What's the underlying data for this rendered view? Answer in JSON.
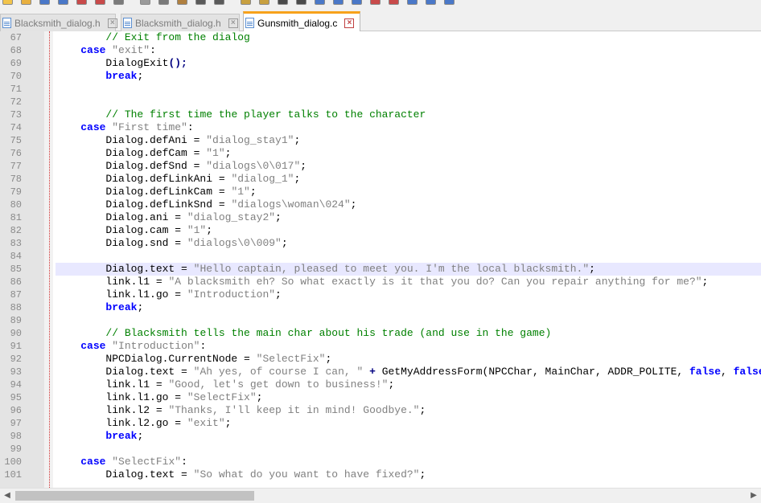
{
  "toolbar": {
    "icons": [
      "new-icon",
      "open-icon",
      "save-icon",
      "save-all-icon",
      "close-icon",
      "close-all-icon",
      "print-icon",
      "cut-icon",
      "copy-icon",
      "paste-icon",
      "undo-icon",
      "redo-icon",
      "find-icon",
      "replace-icon",
      "zoom-in-icon",
      "zoom-out-icon",
      "sync-icon",
      "wrap-icon",
      "indent-icon",
      "bookmark-icon",
      "macro-record-icon",
      "macro-play-icon",
      "macro-save-icon",
      "run-icon"
    ]
  },
  "tabs": [
    {
      "label": "Blacksmith_dialog.h",
      "active": false
    },
    {
      "label": "Blacksmith_dialog.h",
      "active": false
    },
    {
      "label": "Gunsmith_dialog.c",
      "active": true
    }
  ],
  "editor": {
    "current_line": 85,
    "lines": [
      {
        "n": "67",
        "t": [
          [
            "",
            "        "
          ],
          [
            "cm",
            "// Exit from the dialog"
          ]
        ]
      },
      {
        "n": "68",
        "t": [
          [
            "",
            "    "
          ],
          [
            "kw",
            "case"
          ],
          [
            "",
            " "
          ],
          [
            "st",
            "\"exit\""
          ],
          [
            "",
            ":"
          ]
        ]
      },
      {
        "n": "69",
        "t": [
          [
            "",
            "        DialogExit"
          ],
          [
            "op",
            "();"
          ]
        ]
      },
      {
        "n": "70",
        "t": [
          [
            "",
            "        "
          ],
          [
            "kw",
            "break"
          ],
          [
            "",
            ";"
          ]
        ]
      },
      {
        "n": "71",
        "t": []
      },
      {
        "n": "72",
        "t": []
      },
      {
        "n": "73",
        "t": [
          [
            "",
            "        "
          ],
          [
            "cm",
            "// The first time the player talks to the character"
          ]
        ]
      },
      {
        "n": "74",
        "t": [
          [
            "",
            "    "
          ],
          [
            "kw",
            "case"
          ],
          [
            "",
            " "
          ],
          [
            "st",
            "\"First time\""
          ],
          [
            "",
            ":"
          ]
        ]
      },
      {
        "n": "75",
        "t": [
          [
            "",
            "        Dialog.defAni = "
          ],
          [
            "st",
            "\"dialog_stay1\""
          ],
          [
            "",
            ";"
          ]
        ]
      },
      {
        "n": "76",
        "t": [
          [
            "",
            "        Dialog.defCam = "
          ],
          [
            "st",
            "\"1\""
          ],
          [
            "",
            ";"
          ]
        ]
      },
      {
        "n": "77",
        "t": [
          [
            "",
            "        Dialog.defSnd = "
          ],
          [
            "st",
            "\"dialogs\\0\\017\""
          ],
          [
            "",
            ";"
          ]
        ]
      },
      {
        "n": "78",
        "t": [
          [
            "",
            "        Dialog.defLinkAni = "
          ],
          [
            "st",
            "\"dialog_1\""
          ],
          [
            "",
            ";"
          ]
        ]
      },
      {
        "n": "79",
        "t": [
          [
            "",
            "        Dialog.defLinkCam = "
          ],
          [
            "st",
            "\"1\""
          ],
          [
            "",
            ";"
          ]
        ]
      },
      {
        "n": "80",
        "t": [
          [
            "",
            "        Dialog.defLinkSnd = "
          ],
          [
            "st",
            "\"dialogs\\woman\\024\""
          ],
          [
            "",
            ";"
          ]
        ]
      },
      {
        "n": "81",
        "t": [
          [
            "",
            "        Dialog.ani = "
          ],
          [
            "st",
            "\"dialog_stay2\""
          ],
          [
            "",
            ";"
          ]
        ]
      },
      {
        "n": "82",
        "t": [
          [
            "",
            "        Dialog.cam = "
          ],
          [
            "st",
            "\"1\""
          ],
          [
            "",
            ";"
          ]
        ]
      },
      {
        "n": "83",
        "t": [
          [
            "",
            "        Dialog.snd = "
          ],
          [
            "st",
            "\"dialogs\\0\\009\""
          ],
          [
            "",
            ";"
          ]
        ]
      },
      {
        "n": "84",
        "t": []
      },
      {
        "n": "85",
        "t": [
          [
            "",
            "        Dialog.text = "
          ],
          [
            "st",
            "\"Hello captain, pleased to meet you. I'm the local blacksmith.\""
          ],
          [
            "",
            ";"
          ]
        ]
      },
      {
        "n": "86",
        "t": [
          [
            "",
            "        link.l1 = "
          ],
          [
            "st",
            "\"A blacksmith eh? So what exactly is it that you do? Can you repair anything for me?\""
          ],
          [
            "",
            ";"
          ]
        ]
      },
      {
        "n": "87",
        "t": [
          [
            "",
            "        link.l1.go = "
          ],
          [
            "st",
            "\"Introduction\""
          ],
          [
            "",
            ";"
          ]
        ]
      },
      {
        "n": "88",
        "t": [
          [
            "",
            "        "
          ],
          [
            "kw",
            "break"
          ],
          [
            "",
            ";"
          ]
        ]
      },
      {
        "n": "89",
        "t": []
      },
      {
        "n": "90",
        "t": [
          [
            "",
            "        "
          ],
          [
            "cm",
            "// Blacksmith tells the main char about his trade (and use in the game)"
          ]
        ]
      },
      {
        "n": "91",
        "t": [
          [
            "",
            "    "
          ],
          [
            "kw",
            "case"
          ],
          [
            "",
            " "
          ],
          [
            "st",
            "\"Introduction\""
          ],
          [
            "",
            ":"
          ]
        ]
      },
      {
        "n": "92",
        "t": [
          [
            "",
            "        NPCDialog.CurrentNode = "
          ],
          [
            "st",
            "\"SelectFix\""
          ],
          [
            "",
            ";"
          ]
        ]
      },
      {
        "n": "93",
        "t": [
          [
            "",
            "        Dialog.text = "
          ],
          [
            "st",
            "\"Ah yes, of course I can, \""
          ],
          [
            "",
            " "
          ],
          [
            "op",
            "+"
          ],
          [
            "",
            " GetMyAddressForm(NPCChar, MainChar, ADDR_POLITE, "
          ],
          [
            "kw",
            "false"
          ],
          [
            "",
            ", "
          ],
          [
            "kw",
            "false"
          ]
        ]
      },
      {
        "n": "94",
        "t": [
          [
            "",
            "        link.l1 = "
          ],
          [
            "st",
            "\"Good, let's get down to business!\""
          ],
          [
            "",
            ";"
          ]
        ]
      },
      {
        "n": "95",
        "t": [
          [
            "",
            "        link.l1.go = "
          ],
          [
            "st",
            "\"SelectFix\""
          ],
          [
            "",
            ";"
          ]
        ]
      },
      {
        "n": "96",
        "t": [
          [
            "",
            "        link.l2 = "
          ],
          [
            "st",
            "\"Thanks, I'll keep it in mind! Goodbye.\""
          ],
          [
            "",
            ";"
          ]
        ]
      },
      {
        "n": "97",
        "t": [
          [
            "",
            "        link.l2.go = "
          ],
          [
            "st",
            "\"exit\""
          ],
          [
            "",
            ";"
          ]
        ]
      },
      {
        "n": "98",
        "t": [
          [
            "",
            "        "
          ],
          [
            "kw",
            "break"
          ],
          [
            "",
            ";"
          ]
        ]
      },
      {
        "n": "99",
        "t": []
      },
      {
        "n": "100",
        "t": [
          [
            "",
            "    "
          ],
          [
            "kw",
            "case"
          ],
          [
            "",
            " "
          ],
          [
            "st",
            "\"SelectFix\""
          ],
          [
            "",
            ":"
          ]
        ]
      },
      {
        "n": "101",
        "t": [
          [
            "",
            "        Dialog.text = "
          ],
          [
            "st",
            "\"So what do you want to have fixed?\""
          ],
          [
            "",
            ";"
          ]
        ]
      }
    ]
  },
  "scrollbar": {
    "left_arrow": "◀",
    "right_arrow": "▶"
  }
}
